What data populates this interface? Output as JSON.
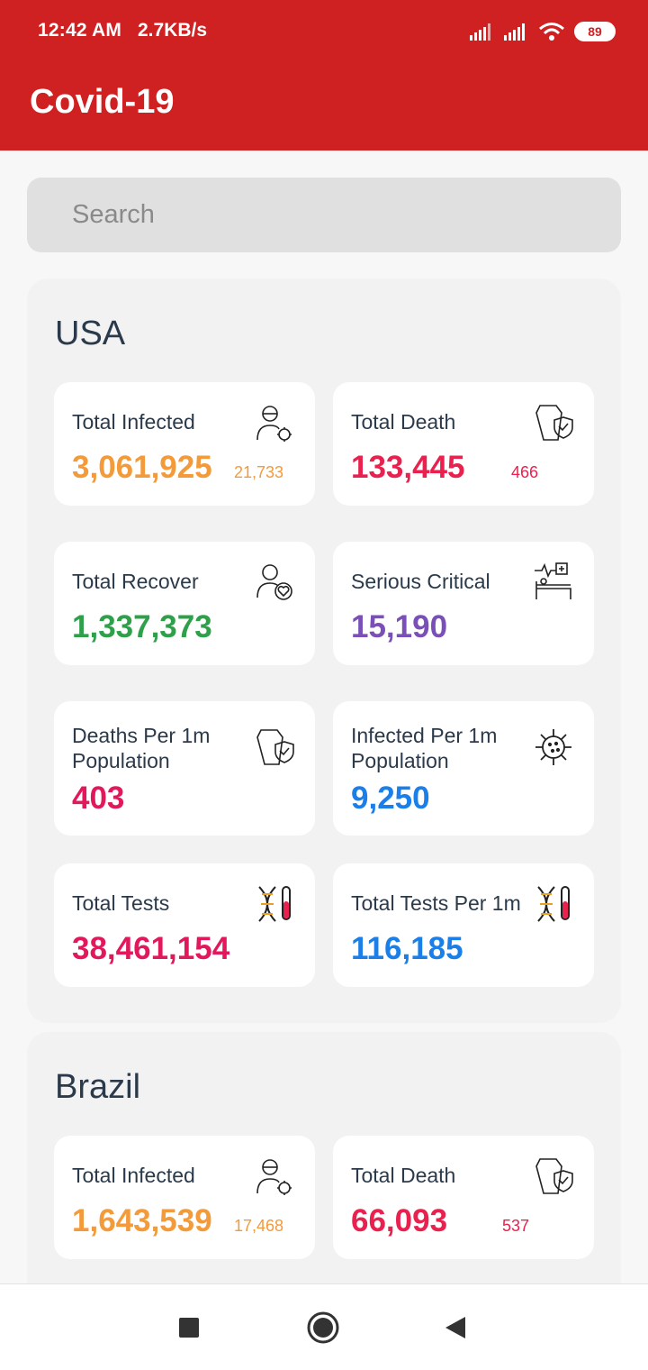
{
  "status_bar": {
    "time": "12:42 AM",
    "net_speed": "2.7KB/s",
    "battery": "89",
    "icons": [
      "signal-icon",
      "signal-icon",
      "wifi-icon",
      "battery-icon"
    ]
  },
  "app": {
    "title": "Covid-19",
    "accent": "#cf2121"
  },
  "search": {
    "placeholder": "Search",
    "value": ""
  },
  "colors": {
    "infected": "#f39a3a",
    "death": "#e8214f",
    "recover": "#2ea04a",
    "critical": "#7a4fb8",
    "per1m_death": "#e2185c",
    "per1m_infected": "#1a7fe8",
    "tests": "#e2185c",
    "tests_per1m": "#1a7fe8"
  },
  "countries": [
    {
      "name": "USA",
      "total_infected": {
        "label": "Total Infected",
        "value": "3,061,925",
        "delta": "21,733",
        "icon": "patient-virus-icon"
      },
      "total_death": {
        "label": "Total Death",
        "value": "133,445",
        "delta": "466",
        "icon": "coffin-shield-icon"
      },
      "total_recover": {
        "label": "Total Recover",
        "value": "1,337,373",
        "icon": "person-heart-icon"
      },
      "serious_critical": {
        "label": "Serious Critical",
        "value": "15,190",
        "icon": "hospital-bed-icon"
      },
      "deaths_per_1m": {
        "label": "Deaths Per 1m Population",
        "value": "403",
        "icon": "coffin-shield-icon"
      },
      "infected_per_1m": {
        "label": "Infected Per 1m Population",
        "value": "9,250",
        "icon": "virus-icon"
      },
      "total_tests": {
        "label": "Total Tests",
        "value": "38,461,154",
        "icon": "dna-test-tube-icon"
      },
      "tests_per_1m": {
        "label": "Total Tests Per 1m",
        "value": "116,185",
        "icon": "dna-test-tube-icon"
      }
    },
    {
      "name": "Brazil",
      "total_infected": {
        "label": "Total Infected",
        "value": "1,643,539",
        "delta": "17,468",
        "icon": "patient-virus-icon"
      },
      "total_death": {
        "label": "Total Death",
        "value": "66,093",
        "delta": "537",
        "icon": "coffin-shield-icon"
      }
    }
  ],
  "nav": {
    "buttons": [
      "recents-button",
      "home-button",
      "back-button"
    ]
  }
}
